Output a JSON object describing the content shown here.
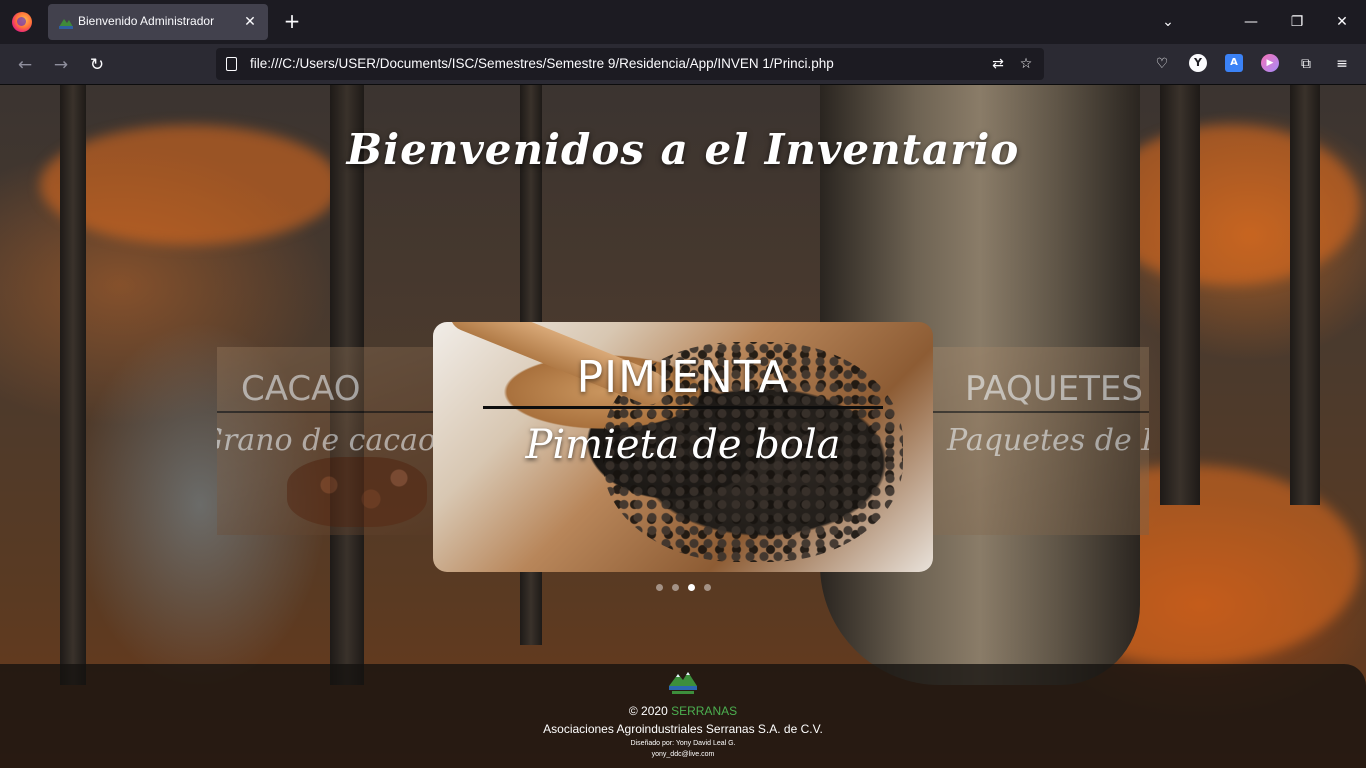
{
  "browser": {
    "tab_title": "Bienvenido Administrador",
    "url": "file:///C:/Users/USER/Documents/ISC/Semestres/Semestre 9/Residencia/App/INVEN 1/Princi.php",
    "icons": {
      "logo": "firefox-logo-icon",
      "favicon": "serranas-favicon-icon",
      "close_tab": "close-icon",
      "new_tab": "plus-icon",
      "tab_list": "chevron-down-icon",
      "back": "arrow-left-icon",
      "forward": "arrow-right-icon",
      "reload": "reload-icon",
      "translate_page": "translate-icon",
      "bookmark": "star-icon",
      "pocket": "pocket-icon",
      "yandex": "y-icon",
      "translate_ext": "translate-extension-icon",
      "media_ext": "play-icon",
      "extensions": "puzzle-icon",
      "menu": "hamburger-icon"
    },
    "window": {
      "minimize": "—",
      "restore": "❐",
      "close": "✕"
    }
  },
  "page": {
    "title": "Bienvenidos a el Inventario",
    "carousel": {
      "slides": [
        {
          "heading": "CACAO",
          "subtitle": "Grano de cacao"
        },
        {
          "heading": "PIMIENTA",
          "subtitle": "Pimieta de bola"
        },
        {
          "heading": "PAQUETES",
          "subtitle": "Paquetes de Ki"
        }
      ],
      "active_index": 2,
      "dot_count": 4
    },
    "footer": {
      "copyright_prefix": "© 2020",
      "brand": "SERRANAS",
      "company": "Asociaciones Agroindustriales Serranas S.A. de C.V.",
      "designer": "Diseñado por: Yony David Leal G.",
      "email": "yony_ddc@live.com"
    }
  },
  "colors": {
    "brand_green": "#4caf50",
    "chrome_dark": "#1c1b22",
    "chrome_toolbar": "#2b2a33"
  }
}
